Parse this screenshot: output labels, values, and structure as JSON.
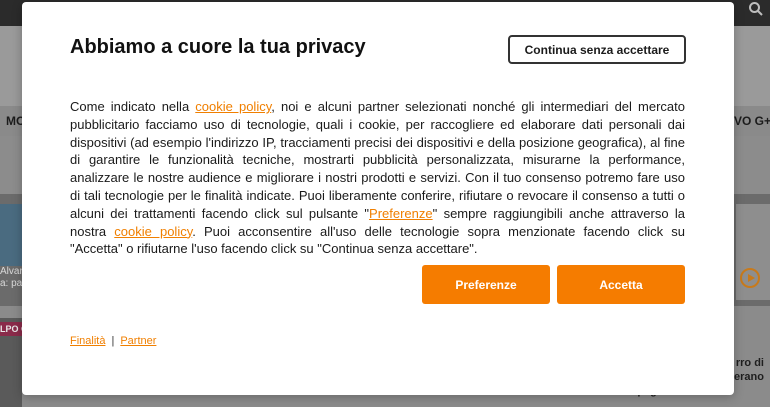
{
  "background": {
    "nav_left": "MO",
    "nav_right": "VO G+",
    "media_left_caption": [
      "Alvare",
      "a: pao"
    ],
    "tag": "LPO G",
    "bottom_right_lines": [
      "rro di",
      "erano",
      "Spagnolo e Procida"
    ]
  },
  "modal": {
    "title": "Abbiamo a cuore la tua privacy",
    "continue_button": "Continua senza accettare",
    "body": {
      "p1": "Come indicato nella ",
      "link1": "cookie policy",
      "p2": ", noi e alcuni partner selezionati nonché gli intermediari del mercato pubblicitario facciamo uso di tecnologie, quali i cookie, per raccogliere ed elaborare dati personali dai dispositivi (ad esempio l'indirizzo IP, tracciamenti precisi dei dispositivi e della posizione geografica), al fine di garantire le funzionalità tecniche, mostrarti pubblicità personalizzata, misurarne la performance, analizzare le nostre audience e migliorare i nostri prodotti e servizi. Con il tuo consenso potremo fare uso di tali tecnologie per le finalità indicate. Puoi liberamente conferire, rifiutare o revocare il consenso a tutti o alcuni dei trattamenti facendo click sul pulsante \"",
      "link2": "Preferenze",
      "p3": "\" sempre raggiungibili anche attraverso la nostra ",
      "link3": "cookie policy",
      "p4": ". Puoi acconsentire all'uso delle tecnologie sopra menzionate facendo click su \"Accetta\" o rifiutarne l'uso facendo click su \"Continua senza accettare\"."
    },
    "preferences_button": "Preferenze",
    "accept_button": "Accetta",
    "footer": {
      "purposes_link": "Finalità",
      "separator": "|",
      "partner_link": "Partner"
    }
  },
  "colors": {
    "accent": "#f57c00",
    "link": "#f07f00",
    "overlay": "#8f8f8f"
  }
}
